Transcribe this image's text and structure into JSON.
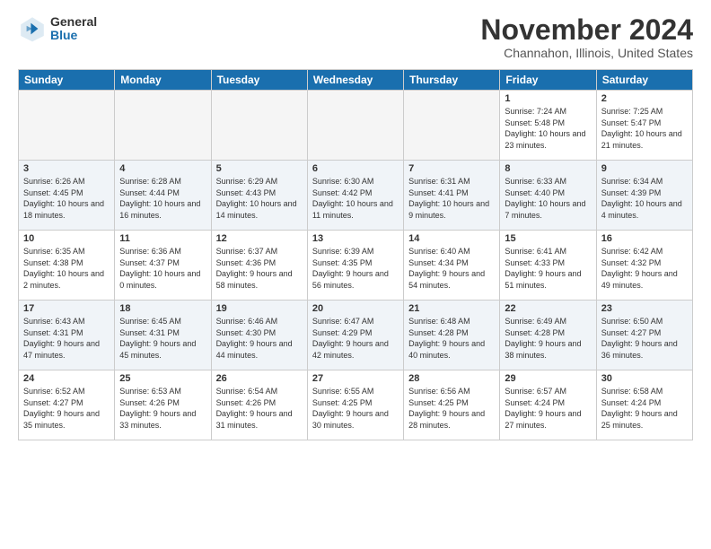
{
  "header": {
    "logo_general": "General",
    "logo_blue": "Blue",
    "month_title": "November 2024",
    "location": "Channahon, Illinois, United States"
  },
  "weekdays": [
    "Sunday",
    "Monday",
    "Tuesday",
    "Wednesday",
    "Thursday",
    "Friday",
    "Saturday"
  ],
  "weeks": [
    [
      {
        "day": "",
        "empty": true
      },
      {
        "day": "",
        "empty": true
      },
      {
        "day": "",
        "empty": true
      },
      {
        "day": "",
        "empty": true
      },
      {
        "day": "",
        "empty": true
      },
      {
        "day": "1",
        "sunrise": "Sunrise: 7:24 AM",
        "sunset": "Sunset: 5:48 PM",
        "daylight": "Daylight: 10 hours and 23 minutes."
      },
      {
        "day": "2",
        "sunrise": "Sunrise: 7:25 AM",
        "sunset": "Sunset: 5:47 PM",
        "daylight": "Daylight: 10 hours and 21 minutes."
      }
    ],
    [
      {
        "day": "3",
        "sunrise": "Sunrise: 6:26 AM",
        "sunset": "Sunset: 4:45 PM",
        "daylight": "Daylight: 10 hours and 18 minutes."
      },
      {
        "day": "4",
        "sunrise": "Sunrise: 6:28 AM",
        "sunset": "Sunset: 4:44 PM",
        "daylight": "Daylight: 10 hours and 16 minutes."
      },
      {
        "day": "5",
        "sunrise": "Sunrise: 6:29 AM",
        "sunset": "Sunset: 4:43 PM",
        "daylight": "Daylight: 10 hours and 14 minutes."
      },
      {
        "day": "6",
        "sunrise": "Sunrise: 6:30 AM",
        "sunset": "Sunset: 4:42 PM",
        "daylight": "Daylight: 10 hours and 11 minutes."
      },
      {
        "day": "7",
        "sunrise": "Sunrise: 6:31 AM",
        "sunset": "Sunset: 4:41 PM",
        "daylight": "Daylight: 10 hours and 9 minutes."
      },
      {
        "day": "8",
        "sunrise": "Sunrise: 6:33 AM",
        "sunset": "Sunset: 4:40 PM",
        "daylight": "Daylight: 10 hours and 7 minutes."
      },
      {
        "day": "9",
        "sunrise": "Sunrise: 6:34 AM",
        "sunset": "Sunset: 4:39 PM",
        "daylight": "Daylight: 10 hours and 4 minutes."
      }
    ],
    [
      {
        "day": "10",
        "sunrise": "Sunrise: 6:35 AM",
        "sunset": "Sunset: 4:38 PM",
        "daylight": "Daylight: 10 hours and 2 minutes."
      },
      {
        "day": "11",
        "sunrise": "Sunrise: 6:36 AM",
        "sunset": "Sunset: 4:37 PM",
        "daylight": "Daylight: 10 hours and 0 minutes."
      },
      {
        "day": "12",
        "sunrise": "Sunrise: 6:37 AM",
        "sunset": "Sunset: 4:36 PM",
        "daylight": "Daylight: 9 hours and 58 minutes."
      },
      {
        "day": "13",
        "sunrise": "Sunrise: 6:39 AM",
        "sunset": "Sunset: 4:35 PM",
        "daylight": "Daylight: 9 hours and 56 minutes."
      },
      {
        "day": "14",
        "sunrise": "Sunrise: 6:40 AM",
        "sunset": "Sunset: 4:34 PM",
        "daylight": "Daylight: 9 hours and 54 minutes."
      },
      {
        "day": "15",
        "sunrise": "Sunrise: 6:41 AM",
        "sunset": "Sunset: 4:33 PM",
        "daylight": "Daylight: 9 hours and 51 minutes."
      },
      {
        "day": "16",
        "sunrise": "Sunrise: 6:42 AM",
        "sunset": "Sunset: 4:32 PM",
        "daylight": "Daylight: 9 hours and 49 minutes."
      }
    ],
    [
      {
        "day": "17",
        "sunrise": "Sunrise: 6:43 AM",
        "sunset": "Sunset: 4:31 PM",
        "daylight": "Daylight: 9 hours and 47 minutes."
      },
      {
        "day": "18",
        "sunrise": "Sunrise: 6:45 AM",
        "sunset": "Sunset: 4:31 PM",
        "daylight": "Daylight: 9 hours and 45 minutes."
      },
      {
        "day": "19",
        "sunrise": "Sunrise: 6:46 AM",
        "sunset": "Sunset: 4:30 PM",
        "daylight": "Daylight: 9 hours and 44 minutes."
      },
      {
        "day": "20",
        "sunrise": "Sunrise: 6:47 AM",
        "sunset": "Sunset: 4:29 PM",
        "daylight": "Daylight: 9 hours and 42 minutes."
      },
      {
        "day": "21",
        "sunrise": "Sunrise: 6:48 AM",
        "sunset": "Sunset: 4:28 PM",
        "daylight": "Daylight: 9 hours and 40 minutes."
      },
      {
        "day": "22",
        "sunrise": "Sunrise: 6:49 AM",
        "sunset": "Sunset: 4:28 PM",
        "daylight": "Daylight: 9 hours and 38 minutes."
      },
      {
        "day": "23",
        "sunrise": "Sunrise: 6:50 AM",
        "sunset": "Sunset: 4:27 PM",
        "daylight": "Daylight: 9 hours and 36 minutes."
      }
    ],
    [
      {
        "day": "24",
        "sunrise": "Sunrise: 6:52 AM",
        "sunset": "Sunset: 4:27 PM",
        "daylight": "Daylight: 9 hours and 35 minutes."
      },
      {
        "day": "25",
        "sunrise": "Sunrise: 6:53 AM",
        "sunset": "Sunset: 4:26 PM",
        "daylight": "Daylight: 9 hours and 33 minutes."
      },
      {
        "day": "26",
        "sunrise": "Sunrise: 6:54 AM",
        "sunset": "Sunset: 4:26 PM",
        "daylight": "Daylight: 9 hours and 31 minutes."
      },
      {
        "day": "27",
        "sunrise": "Sunrise: 6:55 AM",
        "sunset": "Sunset: 4:25 PM",
        "daylight": "Daylight: 9 hours and 30 minutes."
      },
      {
        "day": "28",
        "sunrise": "Sunrise: 6:56 AM",
        "sunset": "Sunset: 4:25 PM",
        "daylight": "Daylight: 9 hours and 28 minutes."
      },
      {
        "day": "29",
        "sunrise": "Sunrise: 6:57 AM",
        "sunset": "Sunset: 4:24 PM",
        "daylight": "Daylight: 9 hours and 27 minutes."
      },
      {
        "day": "30",
        "sunrise": "Sunrise: 6:58 AM",
        "sunset": "Sunset: 4:24 PM",
        "daylight": "Daylight: 9 hours and 25 minutes."
      }
    ]
  ]
}
